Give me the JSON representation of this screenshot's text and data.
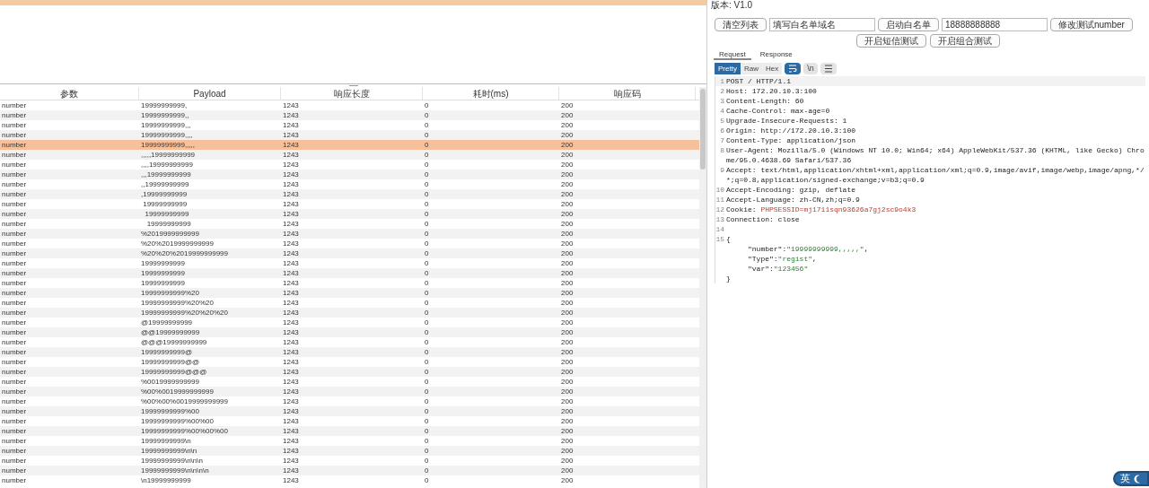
{
  "results_table": {
    "columns": [
      "参数",
      "Payload",
      "响应长度",
      "耗时(ms)",
      "响应码"
    ],
    "rows": [
      {
        "param": "number",
        "payload": "19999999999,",
        "length": "1243",
        "time": "0",
        "code": "200",
        "selected": false
      },
      {
        "param": "number",
        "payload": "19999999999,,",
        "length": "1243",
        "time": "0",
        "code": "200",
        "selected": false
      },
      {
        "param": "number",
        "payload": "19999999999,,,",
        "length": "1243",
        "time": "0",
        "code": "200",
        "selected": false
      },
      {
        "param": "number",
        "payload": "19999999999,,,,",
        "length": "1243",
        "time": "0",
        "code": "200",
        "selected": false
      },
      {
        "param": "number",
        "payload": "19999999999,,,,,",
        "length": "1243",
        "time": "0",
        "code": "200",
        "selected": true
      },
      {
        "param": "number",
        "payload": ",,,,,19999999999",
        "length": "1243",
        "time": "0",
        "code": "200",
        "selected": false
      },
      {
        "param": "number",
        "payload": ",,,,19999999999",
        "length": "1243",
        "time": "0",
        "code": "200",
        "selected": false
      },
      {
        "param": "number",
        "payload": ",,,19999999999",
        "length": "1243",
        "time": "0",
        "code": "200",
        "selected": false
      },
      {
        "param": "number",
        "payload": ",,19999999999",
        "length": "1243",
        "time": "0",
        "code": "200",
        "selected": false
      },
      {
        "param": "number",
        "payload": ",19999999999",
        "length": "1243",
        "time": "0",
        "code": "200",
        "selected": false
      },
      {
        "param": "number",
        "payload": " 19999999999",
        "length": "1243",
        "time": "0",
        "code": "200",
        "selected": false
      },
      {
        "param": "number",
        "payload": "  19999999999",
        "length": "1243",
        "time": "0",
        "code": "200",
        "selected": false
      },
      {
        "param": "number",
        "payload": "   19999999999",
        "length": "1243",
        "time": "0",
        "code": "200",
        "selected": false
      },
      {
        "param": "number",
        "payload": "%2019999999999",
        "length": "1243",
        "time": "0",
        "code": "200",
        "selected": false
      },
      {
        "param": "number",
        "payload": "%20%2019999999999",
        "length": "1243",
        "time": "0",
        "code": "200",
        "selected": false
      },
      {
        "param": "number",
        "payload": "%20%20%2019999999999",
        "length": "1243",
        "time": "0",
        "code": "200",
        "selected": false
      },
      {
        "param": "number",
        "payload": "19999999999",
        "length": "1243",
        "time": "0",
        "code": "200",
        "selected": false
      },
      {
        "param": "number",
        "payload": "19999999999",
        "length": "1243",
        "time": "0",
        "code": "200",
        "selected": false
      },
      {
        "param": "number",
        "payload": "19999999999",
        "length": "1243",
        "time": "0",
        "code": "200",
        "selected": false
      },
      {
        "param": "number",
        "payload": "19999999999%20",
        "length": "1243",
        "time": "0",
        "code": "200",
        "selected": false
      },
      {
        "param": "number",
        "payload": "19999999999%20%20",
        "length": "1243",
        "time": "0",
        "code": "200",
        "selected": false
      },
      {
        "param": "number",
        "payload": "19999999999%20%20%20",
        "length": "1243",
        "time": "0",
        "code": "200",
        "selected": false
      },
      {
        "param": "number",
        "payload": "@19999999999",
        "length": "1243",
        "time": "0",
        "code": "200",
        "selected": false
      },
      {
        "param": "number",
        "payload": "@@19999999999",
        "length": "1243",
        "time": "0",
        "code": "200",
        "selected": false
      },
      {
        "param": "number",
        "payload": "@@@19999999999",
        "length": "1243",
        "time": "0",
        "code": "200",
        "selected": false
      },
      {
        "param": "number",
        "payload": "19999999999@",
        "length": "1243",
        "time": "0",
        "code": "200",
        "selected": false
      },
      {
        "param": "number",
        "payload": "19999999999@@",
        "length": "1243",
        "time": "0",
        "code": "200",
        "selected": false
      },
      {
        "param": "number",
        "payload": "19999999999@@@",
        "length": "1243",
        "time": "0",
        "code": "200",
        "selected": false
      },
      {
        "param": "number",
        "payload": "%0019999999999",
        "length": "1243",
        "time": "0",
        "code": "200",
        "selected": false
      },
      {
        "param": "number",
        "payload": "%00%0019999999999",
        "length": "1243",
        "time": "0",
        "code": "200",
        "selected": false
      },
      {
        "param": "number",
        "payload": "%00%00%0019999999999",
        "length": "1243",
        "time": "0",
        "code": "200",
        "selected": false
      },
      {
        "param": "number",
        "payload": "19999999999%00",
        "length": "1243",
        "time": "0",
        "code": "200",
        "selected": false
      },
      {
        "param": "number",
        "payload": "19999999999%00%00",
        "length": "1243",
        "time": "0",
        "code": "200",
        "selected": false
      },
      {
        "param": "number",
        "payload": "19999999999%00%00%00",
        "length": "1243",
        "time": "0",
        "code": "200",
        "selected": false
      },
      {
        "param": "number",
        "payload": "19999999999\\n",
        "length": "1243",
        "time": "0",
        "code": "200",
        "selected": false
      },
      {
        "param": "number",
        "payload": "19999999999\\n\\n",
        "length": "1243",
        "time": "0",
        "code": "200",
        "selected": false
      },
      {
        "param": "number",
        "payload": "19999999999\\n\\n\\n",
        "length": "1243",
        "time": "0",
        "code": "200",
        "selected": false
      },
      {
        "param": "number",
        "payload": "19999999999\\n\\n\\n\\n",
        "length": "1243",
        "time": "0",
        "code": "200",
        "selected": false
      },
      {
        "param": "number",
        "payload": "\\n19999999999",
        "length": "1243",
        "time": "0",
        "code": "200",
        "selected": false
      }
    ]
  },
  "version": "版本: V1.0",
  "controls": [
    {
      "kind": "button",
      "label": "清空列表"
    },
    {
      "kind": "field",
      "value": "填写白名单域名"
    },
    {
      "kind": "button",
      "label": "启动白名单"
    },
    {
      "kind": "field",
      "value": "18888888888"
    },
    {
      "kind": "button",
      "label": "修改测试number"
    }
  ],
  "test_buttons": [
    "开启短信测试",
    "开启组合测试"
  ],
  "tabs": [
    {
      "label": "Request",
      "selected": true
    },
    {
      "label": "Response",
      "selected": false
    }
  ],
  "view_modes": [
    {
      "label": "Pretty",
      "selected": true
    },
    {
      "label": "Raw",
      "selected": false
    },
    {
      "label": "Hex",
      "selected": false
    }
  ],
  "view_toggles": [
    {
      "kind": "wrap",
      "on": true
    },
    {
      "kind": "newline",
      "label": "\\n",
      "on": false
    },
    {
      "kind": "menu",
      "on": false
    }
  ],
  "request_lines": [
    {
      "num": "1",
      "segments": [
        {
          "kind": "plain",
          "text": "POST / HTTP/1.1"
        }
      ]
    },
    {
      "num": "2",
      "segments": [
        {
          "kind": "plain",
          "text": "Host: 172.20.10.3:100"
        }
      ]
    },
    {
      "num": "3",
      "segments": [
        {
          "kind": "plain",
          "text": "Content-Length: 60"
        }
      ]
    },
    {
      "num": "4",
      "segments": [
        {
          "kind": "plain",
          "text": "Cache-Control: max-age=0"
        }
      ]
    },
    {
      "num": "5",
      "segments": [
        {
          "kind": "plain",
          "text": "Upgrade-Insecure-Requests: 1"
        }
      ]
    },
    {
      "num": "6",
      "segments": [
        {
          "kind": "plain",
          "text": "Origin: http://172.20.10.3:100"
        }
      ]
    },
    {
      "num": "7",
      "segments": [
        {
          "kind": "plain",
          "text": "Content-Type: application/json"
        }
      ]
    },
    {
      "num": "8",
      "segments": [
        {
          "kind": "plain",
          "text": "User-Agent: Mozilla/5.0 (Windows NT 10.0; Win64; x64) AppleWebKit/537.36 (KHTML, like Gecko) Chrome/95.0.4638.69 Safari/537.36"
        }
      ]
    },
    {
      "num": "9",
      "segments": [
        {
          "kind": "plain",
          "text": "Accept: text/html,application/xhtml+xml,application/xml;q=0.9,image/avif,image/webp,image/apng,*/*;q=0.8,application/signed-exchange;v=b3;q=0.9"
        }
      ]
    },
    {
      "num": "10",
      "segments": [
        {
          "kind": "plain",
          "text": "Accept-Encoding: gzip, deflate"
        }
      ]
    },
    {
      "num": "11",
      "segments": [
        {
          "kind": "plain",
          "text": "Accept-Language: zh-CN,zh;q=0.9"
        }
      ]
    },
    {
      "num": "12",
      "segments": [
        {
          "kind": "plain",
          "text": "Cookie: "
        },
        {
          "kind": "cookie",
          "text": "PHPSESSID=mj1711sqn93626a7gj2sc9o4k3"
        }
      ]
    },
    {
      "num": "13",
      "segments": [
        {
          "kind": "plain",
          "text": "Connection: close"
        }
      ]
    },
    {
      "num": "14"
    },
    {
      "num": "15",
      "segments": [
        {
          "kind": "plain",
          "text": "{"
        }
      ]
    },
    {
      "segments": [
        {
          "kind": "indent",
          "text": "\"number\":"
        },
        {
          "kind": "string",
          "text": "\"19999999999,,,,,\""
        },
        {
          "kind": "plain",
          "text": ","
        }
      ]
    },
    {
      "segments": [
        {
          "kind": "indent",
          "text": "\"Type\":"
        },
        {
          "kind": "string",
          "text": "\"regist\""
        },
        {
          "kind": "plain",
          "text": ","
        }
      ]
    },
    {
      "segments": [
        {
          "kind": "indent",
          "text": "\"var\":"
        },
        {
          "kind": "string",
          "text": "\"123456\""
        }
      ]
    },
    {
      "segments": [
        {
          "kind": "plain",
          "text": "}"
        }
      ]
    }
  ],
  "ime_badge": "英"
}
